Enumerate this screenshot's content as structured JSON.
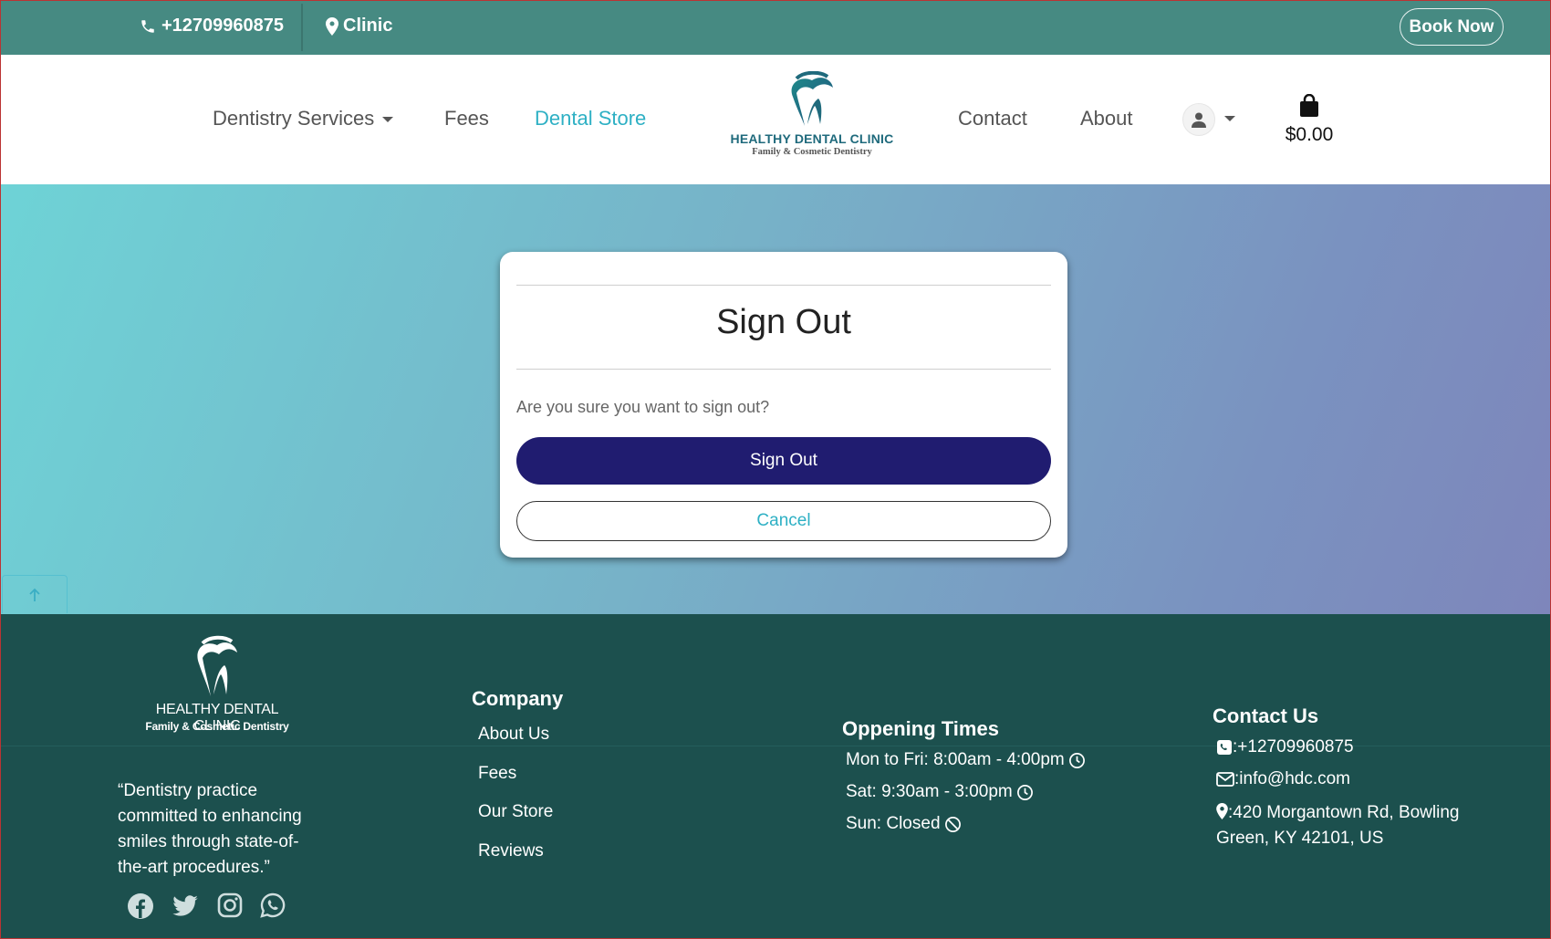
{
  "topbar": {
    "phone": "+12709960875",
    "location": "Clinic",
    "book_label": "Book Now"
  },
  "nav": {
    "services": "Dentistry Services",
    "fees": "Fees",
    "store": "Dental Store",
    "contact": "Contact",
    "about": "About",
    "cart_total": "$0.00",
    "active_color": "#2eb0c4"
  },
  "logo": {
    "name": "HEALTHY DENTAL CLINIC",
    "tagline": "Family & Cosmetic Dentistry"
  },
  "dialog": {
    "title": "Sign Out",
    "question": "Are you sure you want to sign out?",
    "confirm_label": "Sign Out",
    "cancel_label": "Cancel",
    "confirm_color": "#201c70"
  },
  "footer": {
    "quote": "“Dentistry practice committed to enhancing smiles through state-of-the-art procedures.”",
    "company_heading": "Company",
    "company_links": [
      "About Us",
      "Fees",
      "Our Store",
      "Reviews"
    ],
    "hours_heading": "Oppening Times",
    "hours": [
      "Mon to Fri: 8:00am - 4:00pm",
      "Sat: 9:30am - 3:00pm",
      "Sun: Closed"
    ],
    "contact_heading": "Contact Us",
    "contact_phone": ":+12709960875",
    "contact_email": ":info@hdc.com",
    "contact_address": ":420 Morgantown Rd, Bowling Green, KY 42101, US",
    "social": [
      "facebook-icon",
      "twitter-icon",
      "instagram-icon",
      "whatsapp-icon"
    ],
    "bg_color": "#1c504e"
  }
}
